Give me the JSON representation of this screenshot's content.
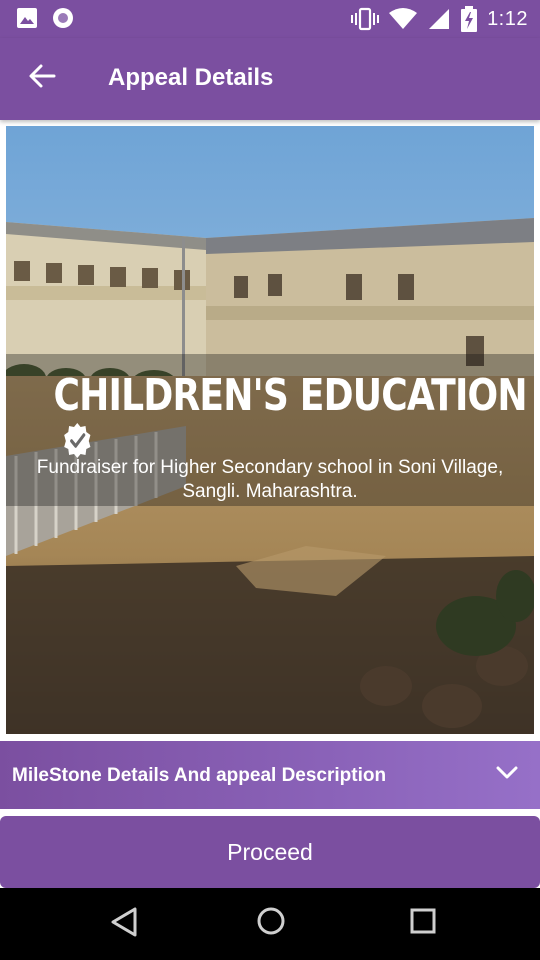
{
  "status_bar": {
    "time": "1:12",
    "icons": [
      "image-icon",
      "circle-notification-icon",
      "vibrate-icon",
      "wifi-icon",
      "signal-icon",
      "battery-charging-icon"
    ]
  },
  "app_bar": {
    "title": "Appeal Details",
    "back_icon": "arrow-left-icon"
  },
  "hero": {
    "title": "CHILDREN'S EDUCATION",
    "verified_icon": "verified-check-icon",
    "subtitle": "Fundraiser for Higher Secondary school in Soni Village, Sangli. Maharashtra."
  },
  "accordion": {
    "label": "MileStone Details And appeal Description",
    "icon": "chevron-down-icon"
  },
  "actions": {
    "proceed_label": "Proceed"
  },
  "nav_bar": {
    "icons": [
      "nav-back-icon",
      "nav-home-icon",
      "nav-recents-icon"
    ]
  },
  "colors": {
    "primary": "#7b4fa0",
    "accordion_end": "#9670c8",
    "nav_bar": "#000000"
  }
}
